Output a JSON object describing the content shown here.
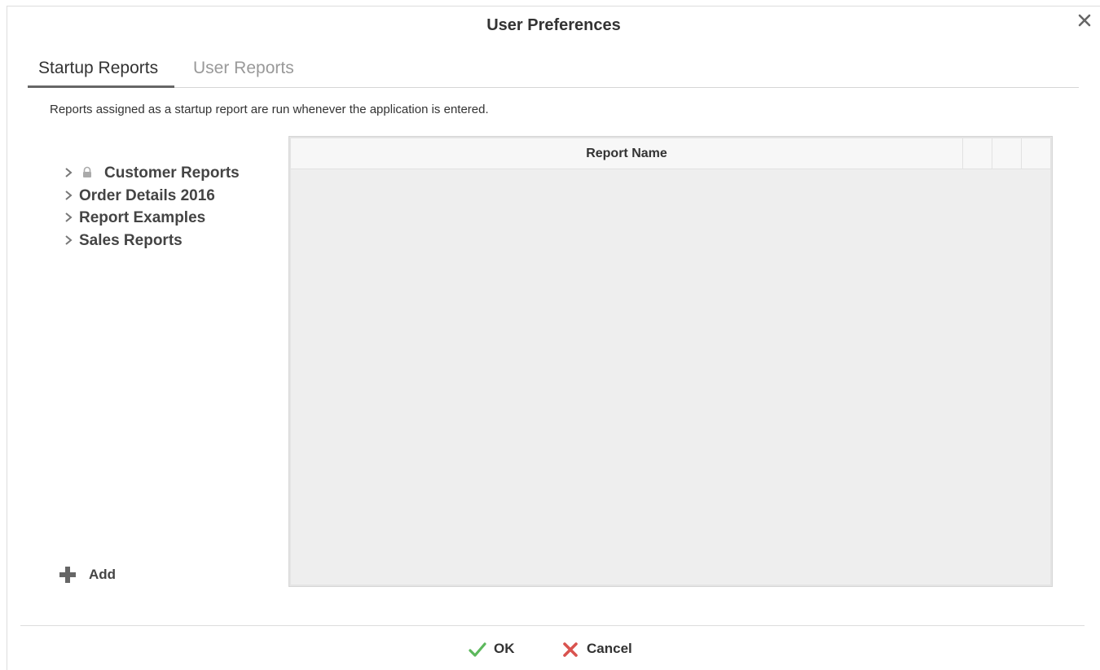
{
  "dialog": {
    "title": "User Preferences",
    "close_icon": "close-icon"
  },
  "tabs": [
    {
      "label": "Startup Reports",
      "active": true
    },
    {
      "label": "User Reports",
      "active": false
    }
  ],
  "description": "Reports assigned as a startup report are run whenever the application is entered.",
  "tree": {
    "items": [
      {
        "label": "Customer Reports",
        "locked": true,
        "icon": "chevron-right-icon"
      },
      {
        "label": "Order Details 2016",
        "locked": false,
        "icon": "chevron-right-icon"
      },
      {
        "label": "Report Examples",
        "locked": false,
        "icon": "chevron-right-icon"
      },
      {
        "label": "Sales Reports",
        "locked": false,
        "icon": "chevron-right-icon"
      }
    ]
  },
  "add_button": {
    "label": "Add",
    "icon": "plus-icon"
  },
  "grid": {
    "columns": [
      "Report Name",
      "",
      "",
      ""
    ],
    "rows": []
  },
  "footer": {
    "ok_label": "OK",
    "ok_icon": "checkmark-icon",
    "ok_color": "#5cb85c",
    "cancel_label": "Cancel",
    "cancel_icon": "x-icon",
    "cancel_color": "#d9534f"
  }
}
